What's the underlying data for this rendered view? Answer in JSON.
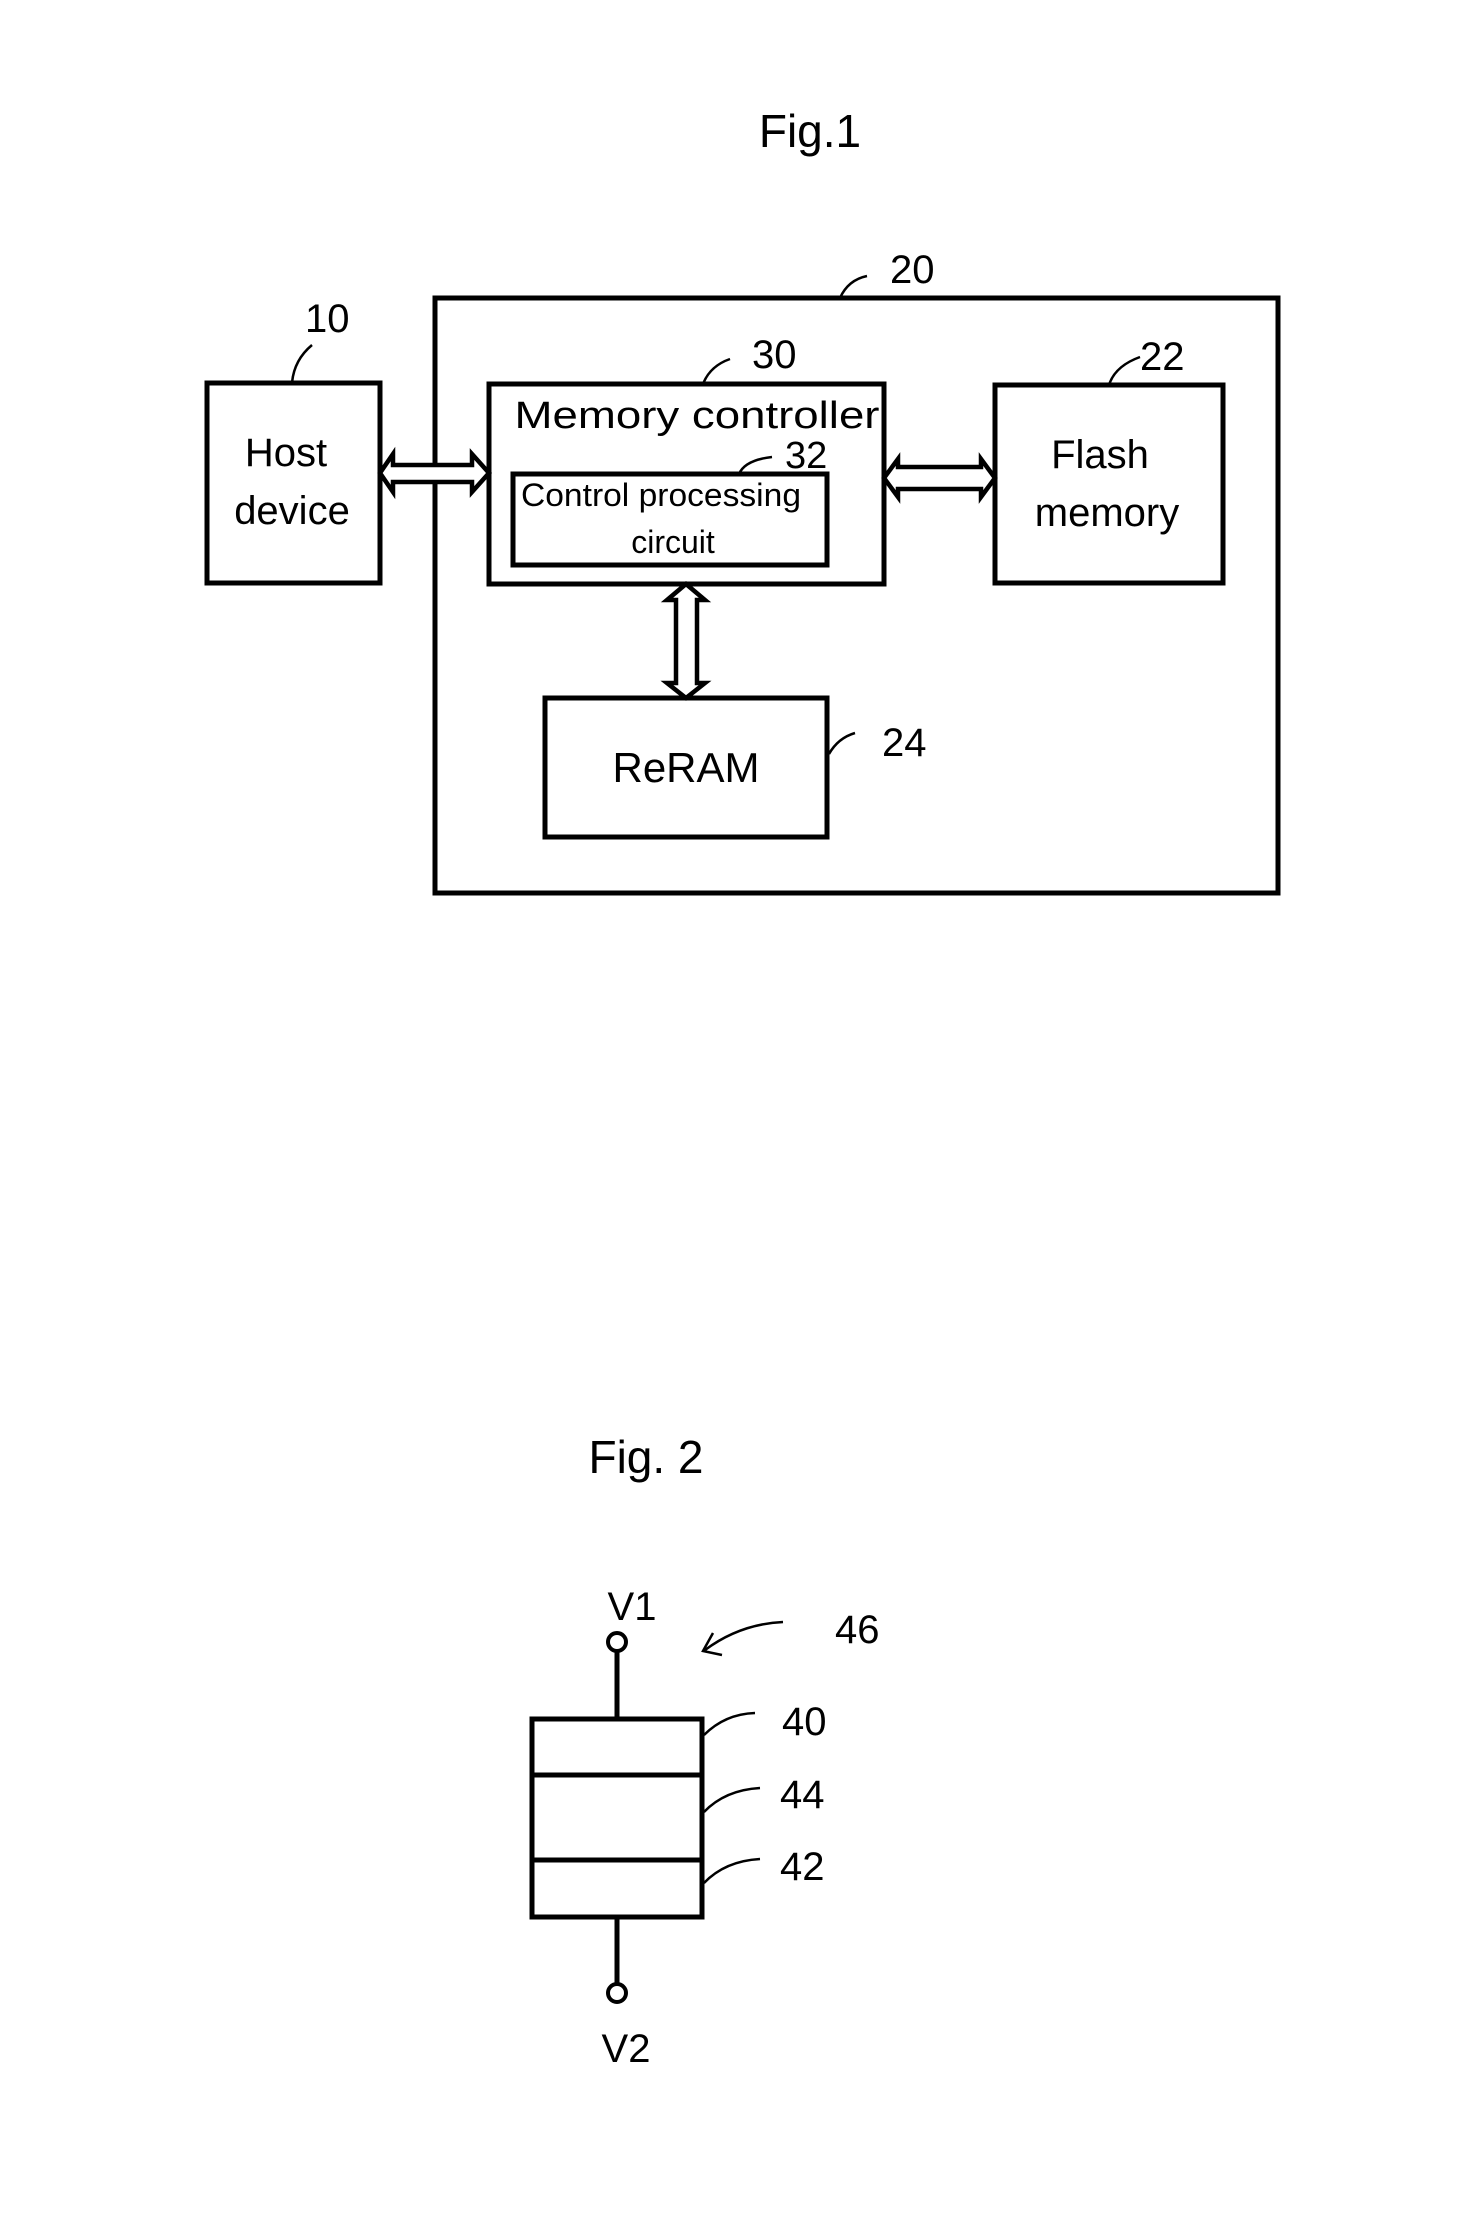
{
  "figure1": {
    "title": "Fig.1",
    "host": {
      "ref": "10",
      "line1": "Host",
      "line2": "device"
    },
    "storage_device": {
      "ref": "20"
    },
    "memory_controller": {
      "ref": "30",
      "label": "Memory controller"
    },
    "control_circuit": {
      "ref": "32",
      "line1": "Control processing",
      "line2": "circuit"
    },
    "flash": {
      "ref": "22",
      "line1": "Flash",
      "line2": "memory"
    },
    "reram": {
      "ref": "24",
      "label": "ReRAM"
    }
  },
  "figure2": {
    "title": "Fig. 2",
    "terminal_top": "V1",
    "terminal_bottom": "V2",
    "element_ref": "46",
    "layers": [
      {
        "ref": "40"
      },
      {
        "ref": "44"
      },
      {
        "ref": "42"
      }
    ]
  }
}
